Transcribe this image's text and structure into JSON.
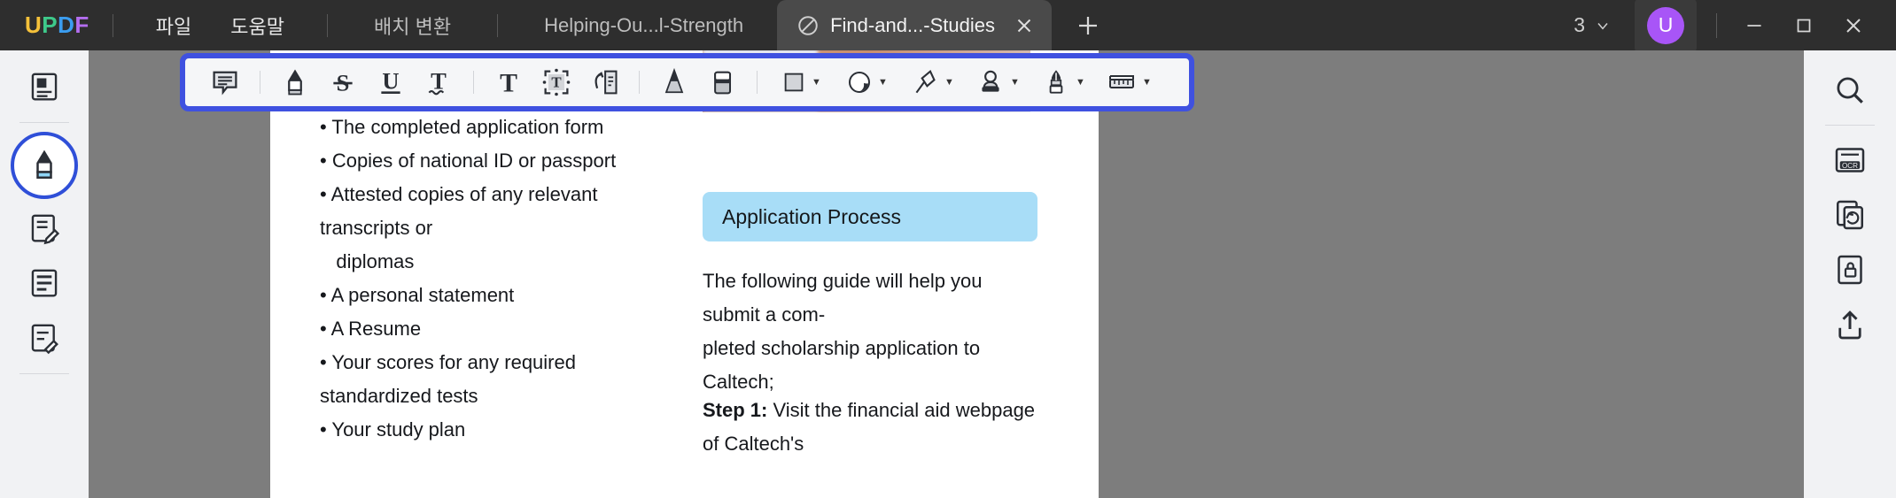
{
  "app": {
    "brand": "UPDF",
    "brand_letters": [
      {
        "ch": "U",
        "color": "#f5c13a"
      },
      {
        "ch": "P",
        "color": "#3ec98a"
      },
      {
        "ch": "D",
        "color": "#3b9df0"
      },
      {
        "ch": "F",
        "color": "#b46ef0"
      }
    ]
  },
  "menu": {
    "items": [
      {
        "label": "파일",
        "name": "menu-file"
      },
      {
        "label": "도움말",
        "name": "menu-help"
      }
    ]
  },
  "tabs": {
    "items": [
      {
        "label": "배치 변환",
        "active": false,
        "name": "tab-batch-convert"
      },
      {
        "label": "Helping-Ou...l-Strength",
        "active": false,
        "name": "tab-helping-out"
      },
      {
        "label": "Find-and...-Studies",
        "active": true,
        "name": "tab-find-and-studies",
        "icon": "no-entry-icon",
        "close": "close-icon"
      }
    ],
    "new_tab_label": "+"
  },
  "window": {
    "page_count": "3",
    "page_count_caret": "⌄",
    "avatar_initial": "U",
    "avatar_color": "#a855f7",
    "minimize": "—",
    "maximize": "□",
    "close": "✕"
  },
  "sidebar": {
    "items": [
      {
        "name": "sidebar-item-organize-pages",
        "icon": "page-thumbnail-icon",
        "selected": false
      },
      {
        "name": "sidebar-item-comment",
        "icon": "highlighter-pen-icon",
        "selected": true
      },
      {
        "name": "sidebar-item-edit-pdf",
        "icon": "edit-document-icon",
        "selected": false
      },
      {
        "name": "sidebar-item-page-layout",
        "icon": "list-document-icon",
        "selected": false
      },
      {
        "name": "sidebar-item-form",
        "icon": "form-document-icon",
        "selected": false
      }
    ]
  },
  "annotation_toolbar": {
    "highlight_color": "#3f51e0",
    "tools": [
      {
        "name": "sticky-note-icon",
        "label": "Note",
        "has_caret": false,
        "group": 1
      },
      {
        "name": "highlighter-icon",
        "label": "Highlight",
        "has_caret": false,
        "group": 2
      },
      {
        "name": "strikethrough-icon",
        "label": "Strikethrough",
        "has_caret": false,
        "group": 2
      },
      {
        "name": "underline-icon",
        "label": "Underline",
        "has_caret": false,
        "group": 2
      },
      {
        "name": "squiggly-underline-icon",
        "label": "Squiggly",
        "has_caret": false,
        "group": 2
      },
      {
        "name": "text-box-icon",
        "label": "Text",
        "has_caret": false,
        "group": 3
      },
      {
        "name": "text-field-icon",
        "label": "Text Box",
        "has_caret": false,
        "group": 3
      },
      {
        "name": "text-callout-icon",
        "label": "Text Callout",
        "has_caret": false,
        "group": 3
      },
      {
        "name": "pencil-icon",
        "label": "Pencil",
        "has_caret": false,
        "group": 4
      },
      {
        "name": "eraser-icon",
        "label": "Eraser",
        "has_caret": false,
        "group": 4
      },
      {
        "name": "shape-square-icon",
        "label": "Shapes",
        "has_caret": true,
        "group": 5
      },
      {
        "name": "sticker-icon",
        "label": "Stickers",
        "has_caret": true,
        "group": 5
      },
      {
        "name": "pin-icon",
        "label": "Stamp Pin",
        "has_caret": true,
        "group": 5
      },
      {
        "name": "stamp-icon",
        "label": "Stamp",
        "has_caret": true,
        "group": 5
      },
      {
        "name": "signature-pen-icon",
        "label": "Signature",
        "has_caret": true,
        "group": 5
      },
      {
        "name": "measure-ruler-icon",
        "label": "Measure",
        "has_caret": true,
        "group": 5
      }
    ]
  },
  "right_rail": {
    "items": [
      {
        "name": "rail-item-search",
        "icon": "search-icon"
      },
      {
        "name": "rail-item-ocr",
        "icon": "ocr-icon"
      },
      {
        "name": "rail-item-convert",
        "icon": "convert-icon"
      },
      {
        "name": "rail-item-protect",
        "icon": "protect-document-icon"
      },
      {
        "name": "rail-item-share",
        "icon": "share-icon"
      }
    ]
  },
  "document": {
    "left_column": [
      "• The completed application form",
      "• Copies of national ID or passport",
      "• Attested copies of any relevant transcripts or",
      "   diplomas",
      "• A personal statement",
      "• A Resume",
      "• Your scores for any required standardized tests",
      "• Your study plan"
    ],
    "callout_heading": "Application Process",
    "paragraph_1": "The following guide will help you submit a com-",
    "paragraph_2": "pleted scholarship application to Caltech;",
    "step_label": "Step 1:",
    "step_text": " Visit the financial aid webpage of Caltech's"
  }
}
